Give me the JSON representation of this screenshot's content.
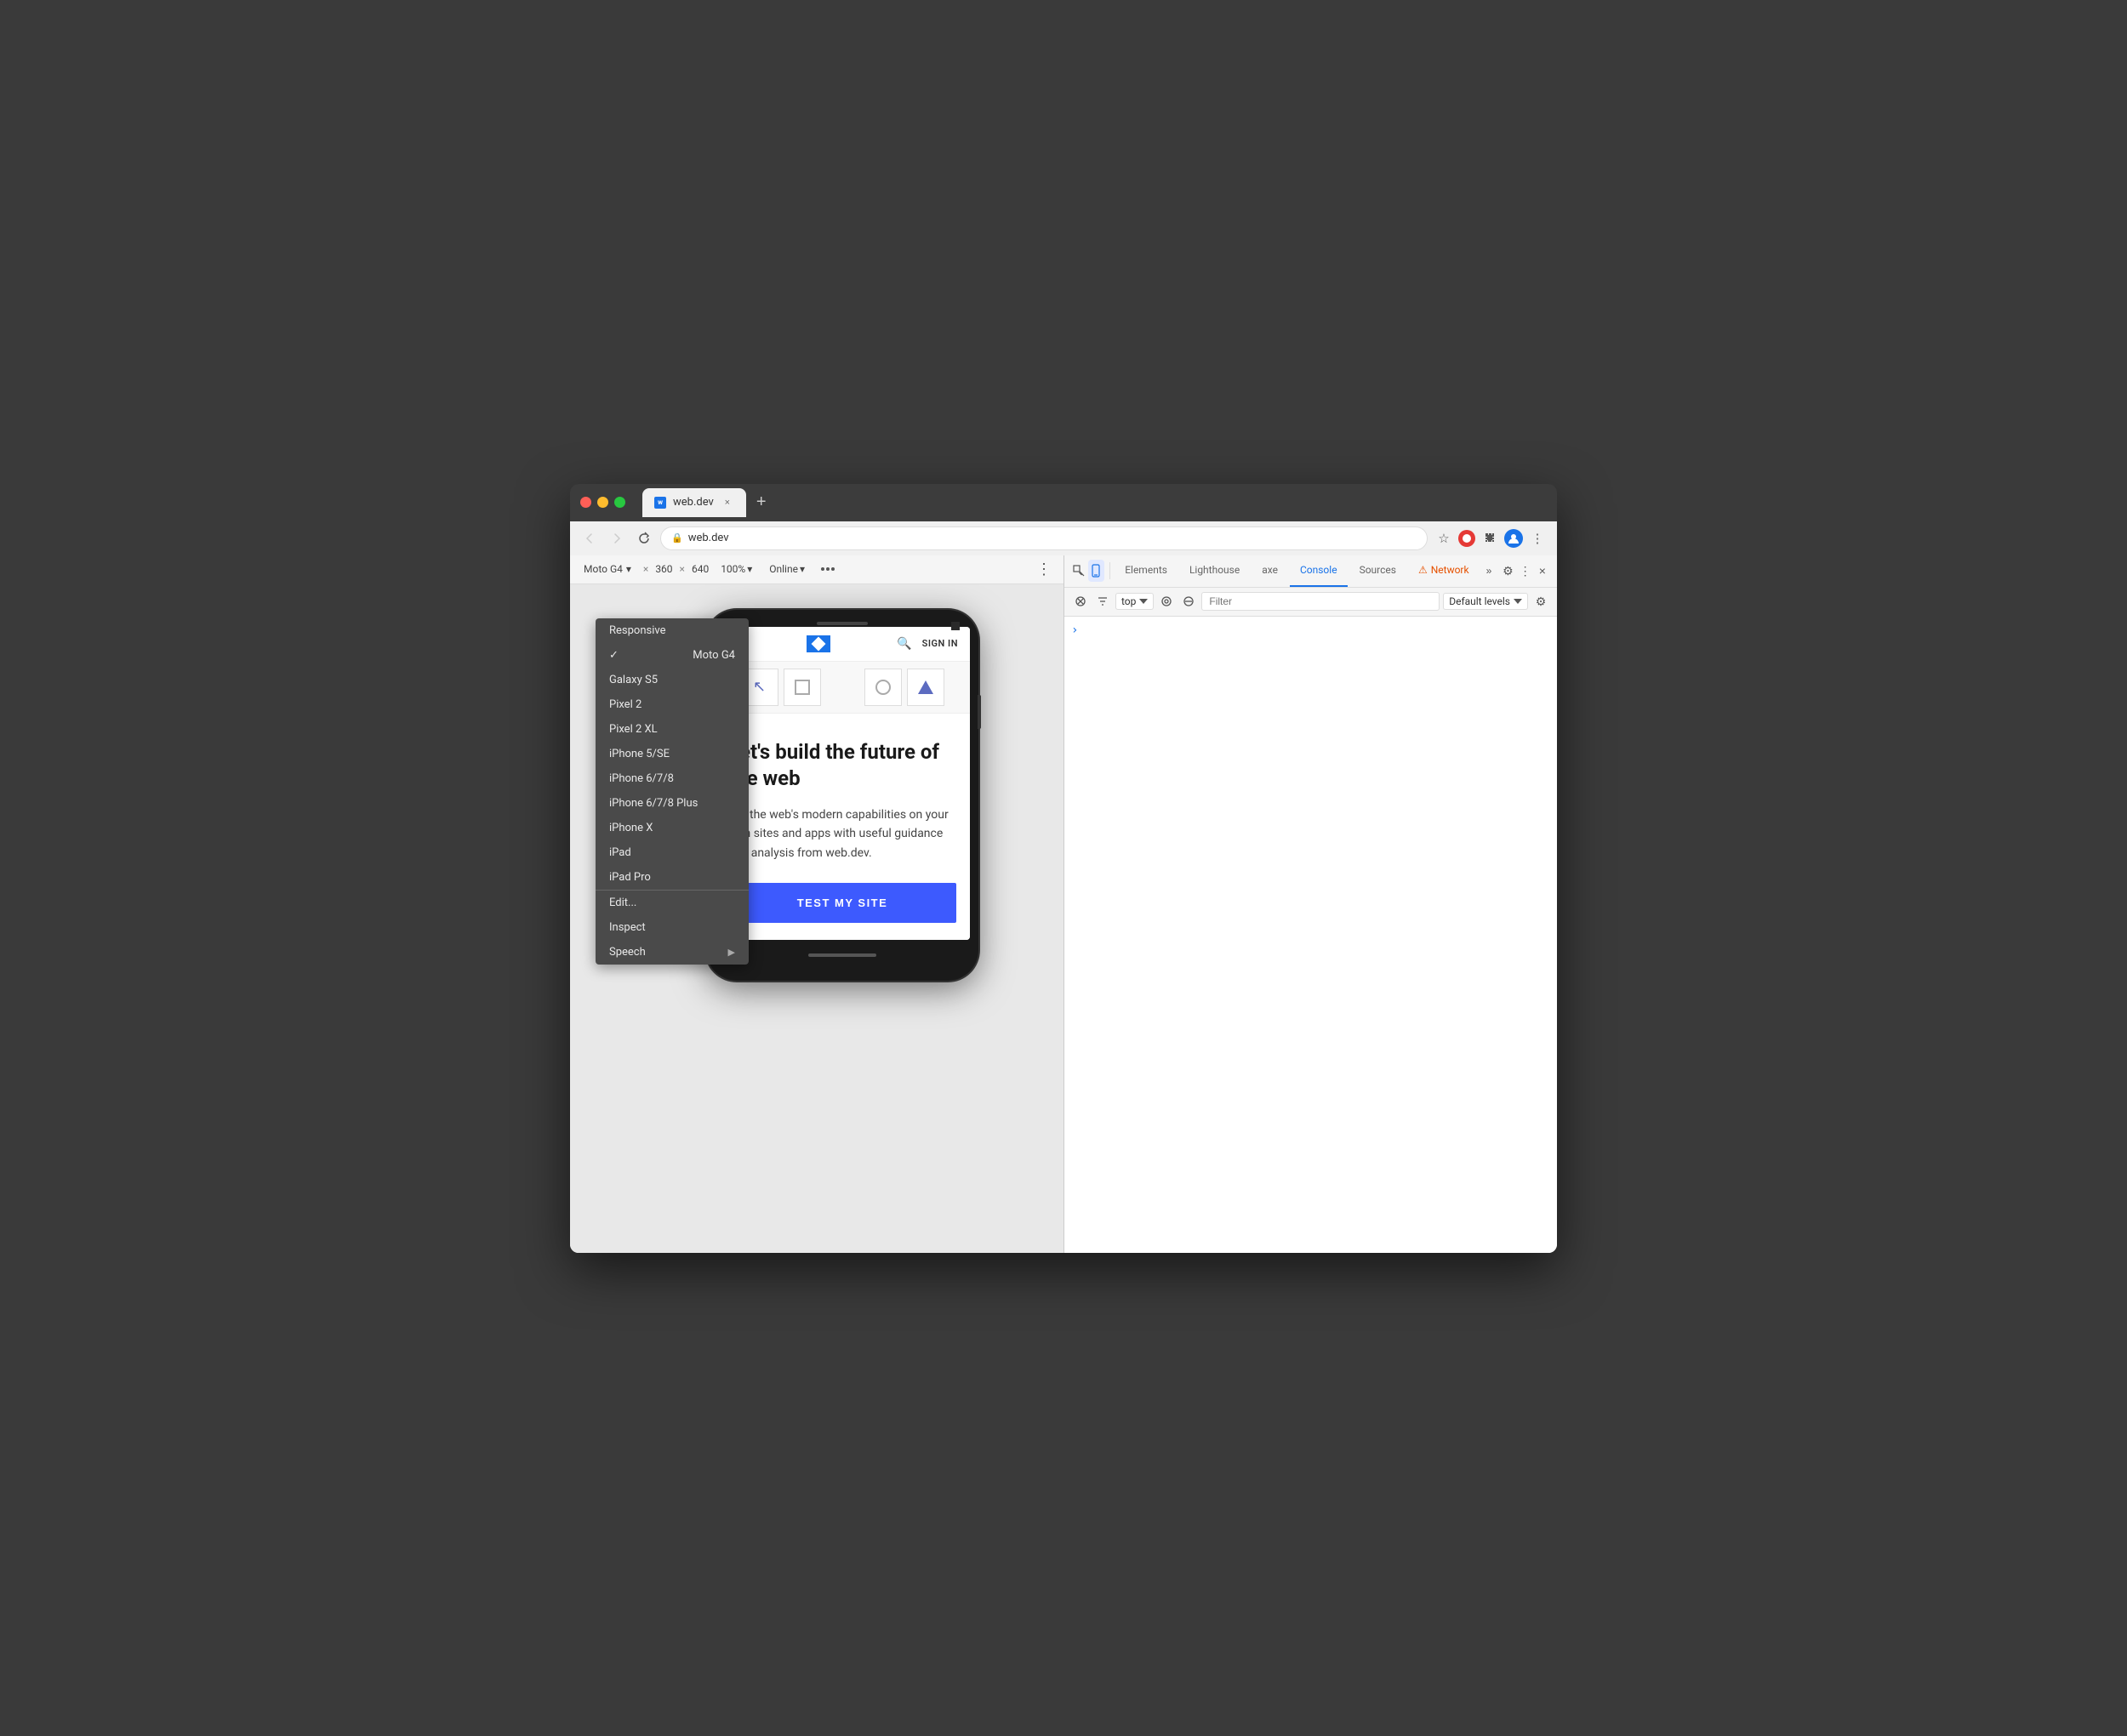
{
  "window": {
    "title": "web.dev",
    "url": "web.dev",
    "favicon_text": "w"
  },
  "titlebar": {
    "close_label": "×",
    "min_label": "–",
    "max_label": "+",
    "add_tab_label": "+"
  },
  "navbar": {
    "back_label": "←",
    "forward_label": "→",
    "reload_label": "↻",
    "url": "web.dev",
    "lock_icon": "🔒",
    "more_label": "⋮"
  },
  "devtools": {
    "tabs": [
      {
        "id": "elements",
        "label": "Elements",
        "active": false
      },
      {
        "id": "lighthouse",
        "label": "Lighthouse",
        "active": false
      },
      {
        "id": "axe",
        "label": "axe",
        "active": false
      },
      {
        "id": "console",
        "label": "Console",
        "active": true
      },
      {
        "id": "sources",
        "label": "Sources",
        "active": false
      },
      {
        "id": "network",
        "label": "Network",
        "active": false,
        "warning": true
      }
    ],
    "more_tabs_label": "»",
    "settings_label": "⚙",
    "more_options_label": "⋮",
    "close_label": "×",
    "console_context": "top",
    "filter_placeholder": "Filter",
    "default_levels": "Default levels",
    "console_arrow": "›"
  },
  "device_toolbar": {
    "device_name": "Moto G4",
    "width": "360",
    "height": "640",
    "zoom": "100%",
    "connection": "Online",
    "chevron": "▾"
  },
  "context_menu": {
    "items": [
      {
        "id": "responsive",
        "label": "Responsive",
        "checked": false,
        "is_header": true
      },
      {
        "id": "moto-g4",
        "label": "Moto G4",
        "checked": true
      },
      {
        "id": "galaxy-s5",
        "label": "Galaxy S5",
        "checked": false
      },
      {
        "id": "pixel-2",
        "label": "Pixel 2",
        "checked": false
      },
      {
        "id": "pixel-2-xl",
        "label": "Pixel 2 XL",
        "checked": false
      },
      {
        "id": "iphone-5-se",
        "label": "iPhone 5/SE",
        "checked": false
      },
      {
        "id": "iphone-678",
        "label": "iPhone 6/7/8",
        "checked": false
      },
      {
        "id": "iphone-678-plus",
        "label": "iPhone 6/7/8 Plus",
        "checked": false
      },
      {
        "id": "iphone-x",
        "label": "iPhone X",
        "checked": false
      },
      {
        "id": "ipad",
        "label": "iPad",
        "checked": false
      },
      {
        "id": "ipad-pro",
        "label": "iPad Pro",
        "checked": false
      },
      {
        "id": "edit",
        "label": "Edit...",
        "separator": true
      },
      {
        "id": "inspect",
        "label": "Inspect",
        "separator": false
      },
      {
        "id": "speech",
        "label": "Speech",
        "has_submenu": true
      }
    ]
  },
  "phone_content": {
    "sign_in": "SIGN IN",
    "hero_title": "Let's build the future of the web",
    "hero_description": "Get the web's modern capabilities on your own sites and apps with useful guidance and analysis from web.dev.",
    "cta_button": "TEST MY SITE"
  }
}
